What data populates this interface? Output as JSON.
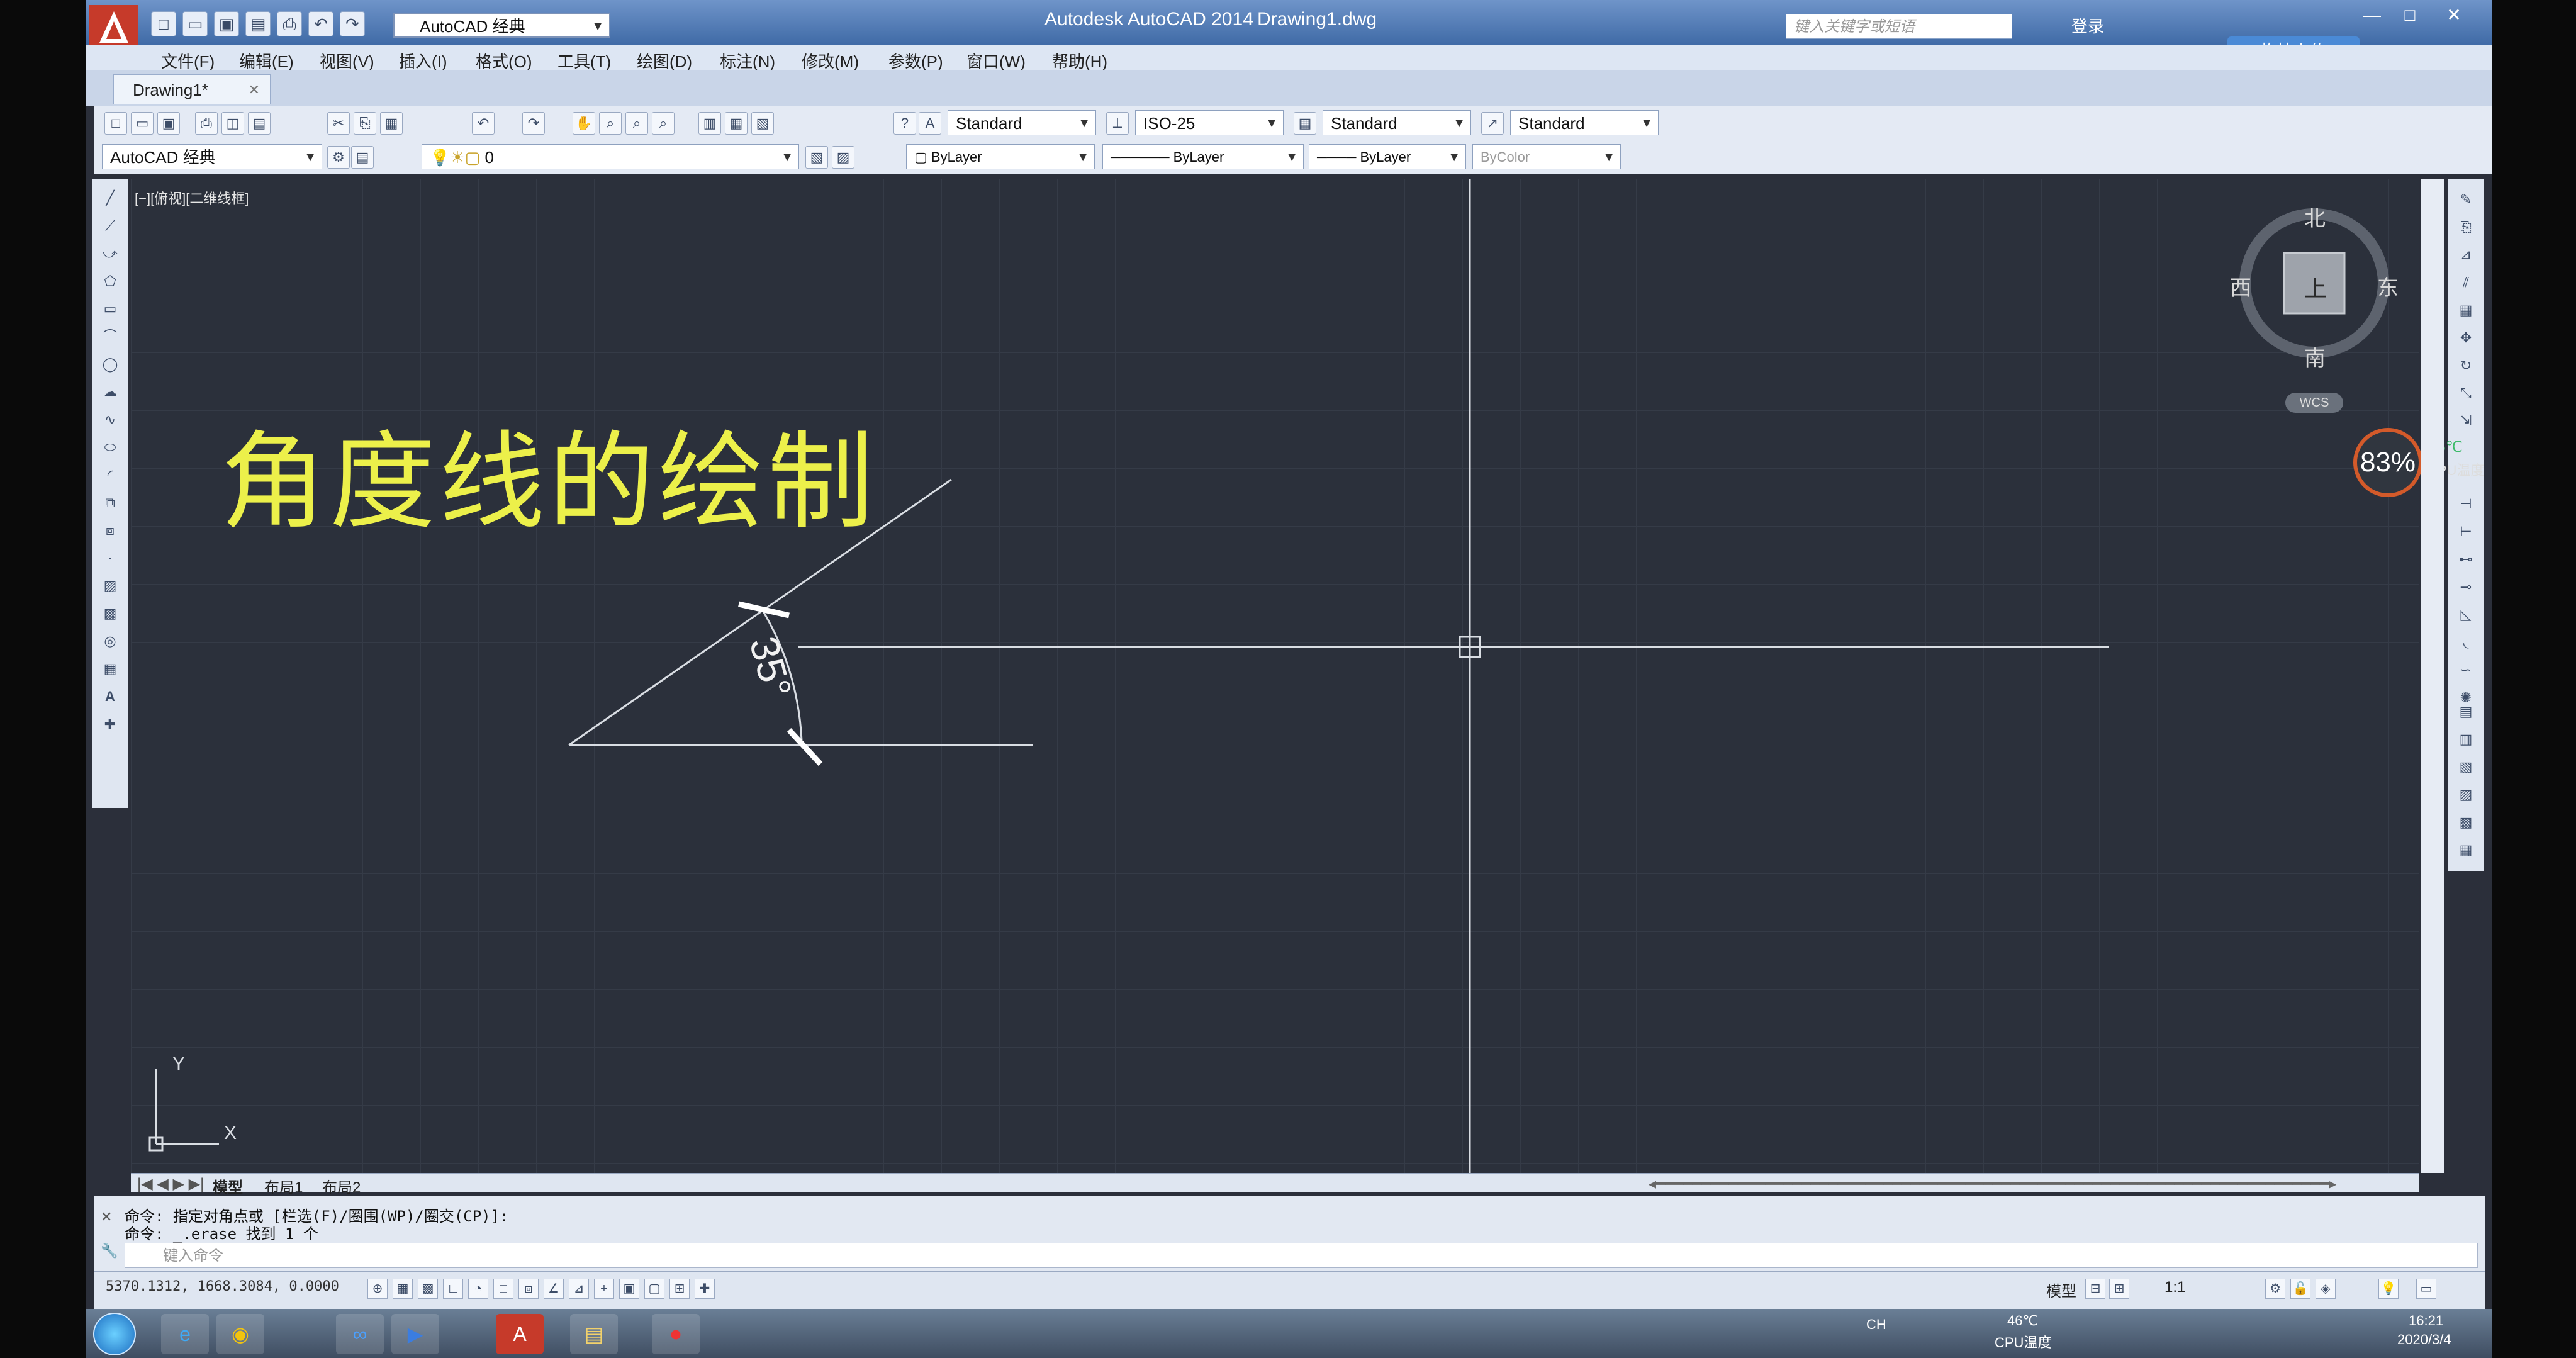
{
  "window": {
    "app_name": "Autodesk AutoCAD 2014",
    "document": "Drawing1.dwg",
    "workspace": "AutoCAD 经典",
    "search_placeholder": "键入关键字或短语",
    "login_label": "登录",
    "upload_badge": "拖拽上传"
  },
  "menu": [
    "文件(F)",
    "编辑(E)",
    "视图(V)",
    "插入(I)",
    "格式(O)",
    "工具(T)",
    "绘图(D)",
    "标注(N)",
    "修改(M)",
    "参数(P)",
    "窗口(W)",
    "帮助(H)"
  ],
  "doc_tab": "Drawing1*",
  "styles": {
    "text_style": "Standard",
    "dim_style": "ISO-25",
    "table_style": "Standard",
    "multileader_style": "Standard",
    "workspace_dropdown": "AutoCAD 经典",
    "layer": "0",
    "color": "ByLayer",
    "linetype": "ByLayer",
    "lineweight": "ByLayer",
    "plotstyle": "ByColor"
  },
  "viewport": {
    "view_label": "[−][俯视][二维线框]",
    "title_text": "角度线的绘制",
    "angle_label": "35°",
    "compass": {
      "north": "北",
      "south": "南",
      "east": "东",
      "west": "西",
      "top": "上",
      "wcs": "WCS"
    },
    "ucs_x": "X",
    "ucs_y": "Y"
  },
  "cpu": {
    "usage": "83%",
    "temp": "46℃",
    "label": "CPU温度"
  },
  "layout_tabs": [
    "模型",
    "布局1",
    "布局2"
  ],
  "command": {
    "line1": "命令: 指定对角点或 [栏选(F)/圈围(WP)/圈交(CP)]:",
    "line2": "命令: _.erase 找到 1 个",
    "input_placeholder": "键入命令"
  },
  "status": {
    "coordinates": "5370.1312, 1668.3084, 0.0000",
    "model_label": "模型",
    "scale": "1:1"
  },
  "taskbar": {
    "lang": "CH",
    "temp": "46℃",
    "temp_label": "CPU温度",
    "time": "16:21",
    "date": "2020/3/4"
  },
  "colors": {
    "canvas_bg": "#2b303b",
    "title_text": "#ecf04a",
    "drawing_lines": "#d9dde3",
    "cpu_ring": "#d35a2a"
  }
}
